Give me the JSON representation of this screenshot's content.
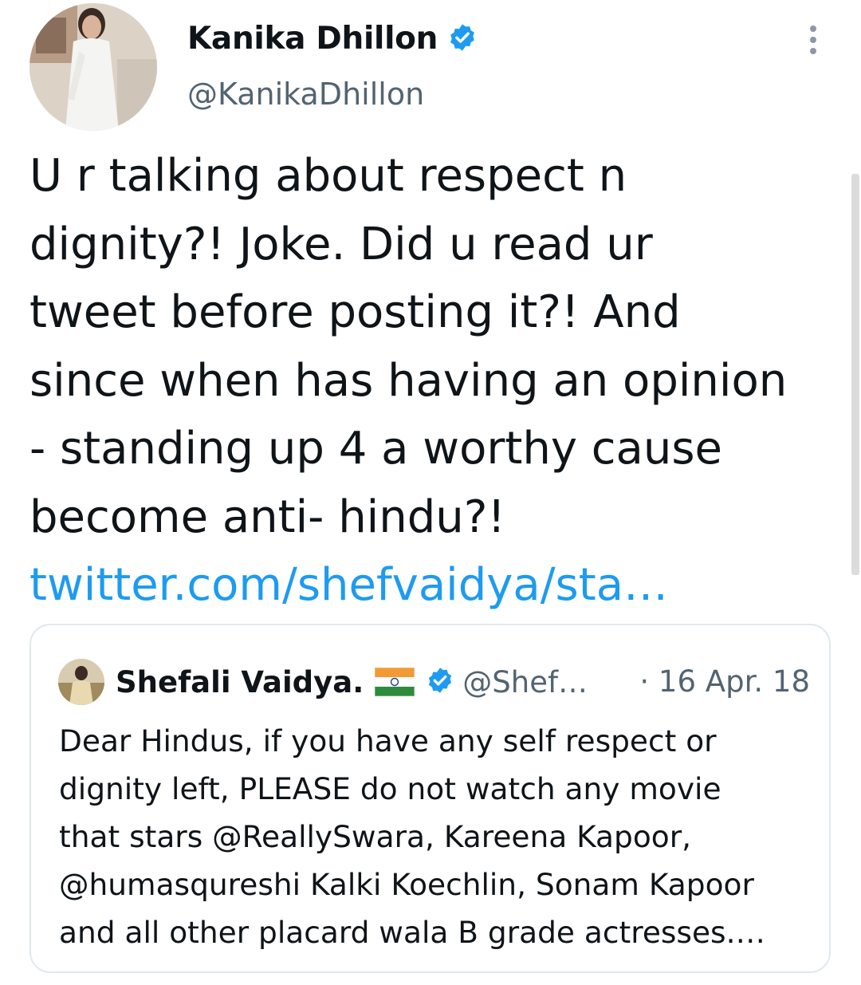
{
  "tweet": {
    "author_name": "Kanika Dhillon",
    "author_handle": "@KanikaDhillon",
    "lines": [
      "U r talking about respect n",
      "dignity?! Joke. Did u read ur",
      "tweet before posting it?! And",
      "since when has having an opinion",
      "- standing up 4 a worthy cause",
      "become anti- hindu?!"
    ],
    "link": "twitter.com/shefvaidya/sta…",
    "verified_icon": "verified-badge-icon",
    "more_icon": "more-options-icon"
  },
  "quote": {
    "author_name": "Shefali Vaidya.",
    "flag_icon": "india-flag-icon",
    "author_handle": "@Shef…",
    "date": "· 16 Apr. 18",
    "lines": [
      "Dear Hindus, if you have any self respect or",
      "dignity left, PLEASE do not watch any movie",
      "that stars @ReallySwara, Kareena Kapoor,",
      "@humasqureshi Kalki Koechlin, Sonam Kapoor",
      "and all other placard wala B grade actresses.…"
    ]
  },
  "colors": {
    "link": "#1d9bf0",
    "secondary_text": "#536471",
    "border": "#e1e8ed"
  }
}
